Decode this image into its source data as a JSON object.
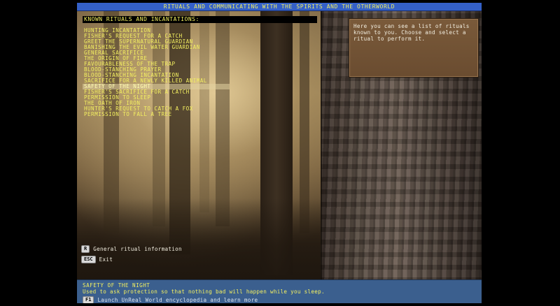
{
  "title": "RITUALS AND COMMUNICATING WITH THE SPIRITS AND THE OTHERWORLD",
  "list_header": "KNOWN RITUALS AND INCANTATIONS:",
  "rituals": [
    "HUNTING INCANTATION",
    "FISHER'S REQUEST FOR A CATCH",
    "GREET THE SUPERNATURAL GUARDIAN",
    "BANISHING THE EVIL WATER GUARDIAN",
    "GENERAL SACRIFICE",
    "THE ORIGIN OF FIRE",
    "FAVOURABLENESS OF THE TRAP",
    "BLOOD-STANCHING PRAYER",
    "BLOOD-STANCHING INCANTATION",
    "SACRIFICE FOR A NEWLY KILLED ANIMAL",
    "SAFETY OF THE NIGHT",
    "FISHER'S SACRIFICE FOR A CATCH",
    "PERMISSION TO SLEEP",
    "THE OATH OF IRON",
    "HUNTER'S REQUEST TO CATCH A FOX",
    "PERMISSION TO FALL A TREE"
  ],
  "help_text": "Here you can see a list of rituals known to you. Choose and select a ritual to perform it.",
  "keys": {
    "general": {
      "key": "R",
      "label": "General ritual information"
    },
    "exit": {
      "key": "ESC",
      "label": "Exit"
    },
    "encyclopedia": {
      "key": "F1",
      "label": "Launch UnReal World encyclopedia and learn more"
    }
  },
  "selected": {
    "name": "SAFETY OF THE NIGHT",
    "description": "Used to ask protection so that nothing bad will happen while you sleep."
  },
  "colors": {
    "text_yellow": "#f4f060",
    "title_bar": "#3460c8",
    "bottom_panel": "#3b5f8e",
    "help_panel": "#7a5a3a"
  }
}
